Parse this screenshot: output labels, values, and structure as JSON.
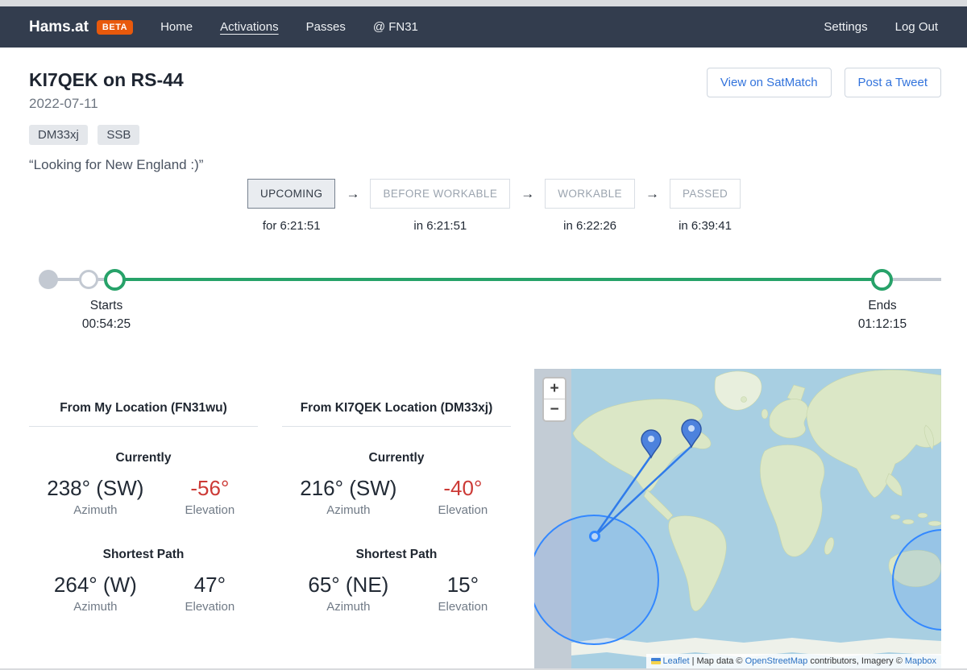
{
  "colors": {
    "navbar_bg": "#333d4e",
    "beta_orange": "#e8590c",
    "link_blue": "#3273dc",
    "elevation_negative_red": "#cc3a36",
    "timeline_green": "#27a269",
    "map_overlay_blue": "#3388ff"
  },
  "navbar": {
    "brand": "Hams.at",
    "beta_badge": "BETA",
    "items": [
      {
        "label": "Home"
      },
      {
        "label": "Activations"
      },
      {
        "label": "Passes"
      },
      {
        "label": "@ FN31"
      }
    ],
    "right_items": [
      {
        "label": "Settings"
      },
      {
        "label": "Log Out"
      }
    ]
  },
  "header": {
    "title": "KI7QEK on RS-44",
    "date": "2022-07-11",
    "tags": [
      {
        "label": "DM33xj"
      },
      {
        "label": "SSB"
      }
    ],
    "quote": "“Looking for New England :)”",
    "buttons": [
      {
        "label": "View on SatMatch"
      },
      {
        "label": "Post a Tweet"
      }
    ]
  },
  "stepper": {
    "arrow": "→",
    "steps": [
      {
        "label": "UPCOMING",
        "time": "for 6:21:51"
      },
      {
        "label": "BEFORE WORKABLE",
        "time": "in 6:21:51"
      },
      {
        "label": "WORKABLE",
        "time": "in 6:22:26"
      },
      {
        "label": "PASSED",
        "time": "in 6:39:41"
      }
    ]
  },
  "timeline": {
    "starts_label": "Starts",
    "starts_time": "00:54:25",
    "ends_label": "Ends",
    "ends_time": "01:12:15"
  },
  "panels": [
    {
      "title": "From My Location (FN31wu)",
      "currently_heading": "Currently",
      "currently_azimuth": "238° (SW)",
      "currently_elevation": "-56°",
      "shortest_heading": "Shortest Path",
      "shortest_azimuth": "264° (W)",
      "shortest_elevation": "47°",
      "azimuth_label": "Azimuth",
      "elevation_label": "Elevation"
    },
    {
      "title": "From KI7QEK Location (DM33xj)",
      "currently_heading": "Currently",
      "currently_azimuth": "216° (SW)",
      "currently_elevation": "-40°",
      "shortest_heading": "Shortest Path",
      "shortest_azimuth": "65° (NE)",
      "shortest_elevation": "15°",
      "azimuth_label": "Azimuth",
      "elevation_label": "Elevation"
    }
  ],
  "map": {
    "zoom_in": "+",
    "zoom_out": "−",
    "attribution": {
      "leaflet": "Leaflet",
      "sep1": " | Map data © ",
      "osm": "OpenStreetMap",
      "sep2": " contributors, Imagery © ",
      "mapbox": "Mapbox"
    }
  }
}
